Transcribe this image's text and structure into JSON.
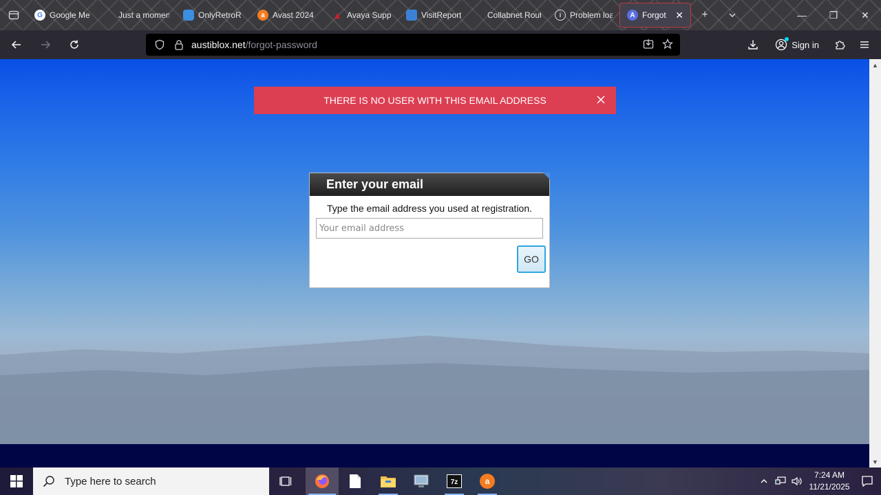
{
  "browser": {
    "tabs": [
      {
        "title": "Google Me",
        "icon": "google-icon",
        "color": "#ffffff"
      },
      {
        "title": "Just a moment...",
        "icon": "",
        "color": ""
      },
      {
        "title": "OnlyRetroR",
        "icon": "retro-icon",
        "color": "#3d8de0"
      },
      {
        "title": "Avast 2024",
        "icon": "avast-icon",
        "color": "#f47b20"
      },
      {
        "title": "Avaya Supp",
        "icon": "avaya-icon",
        "color": "#cc1f2d"
      },
      {
        "title": "VisitReport",
        "icon": "report-icon",
        "color": "#3b82d6"
      },
      {
        "title": "Collabnet Router",
        "icon": "",
        "color": ""
      },
      {
        "title": "Problem loa",
        "icon": "info-icon",
        "color": ""
      },
      {
        "title": "Forgot pa",
        "icon": "austiblox-icon",
        "color": "#5b6ee0",
        "active": true
      }
    ],
    "url_domain": "austiblox.net",
    "url_path": "/forgot-password",
    "sign_in_label": "Sign in"
  },
  "page": {
    "alert_text": "THERE IS NO USER WITH THIS EMAIL ADDRESS",
    "modal": {
      "title": "Enter your email",
      "description": "Type the email address you used at registration.",
      "email_placeholder": "Your email address",
      "go_label": "GO"
    }
  },
  "taskbar": {
    "search_placeholder": "Type here to search",
    "time": "7:24 AM",
    "date": "11/21/2025"
  }
}
